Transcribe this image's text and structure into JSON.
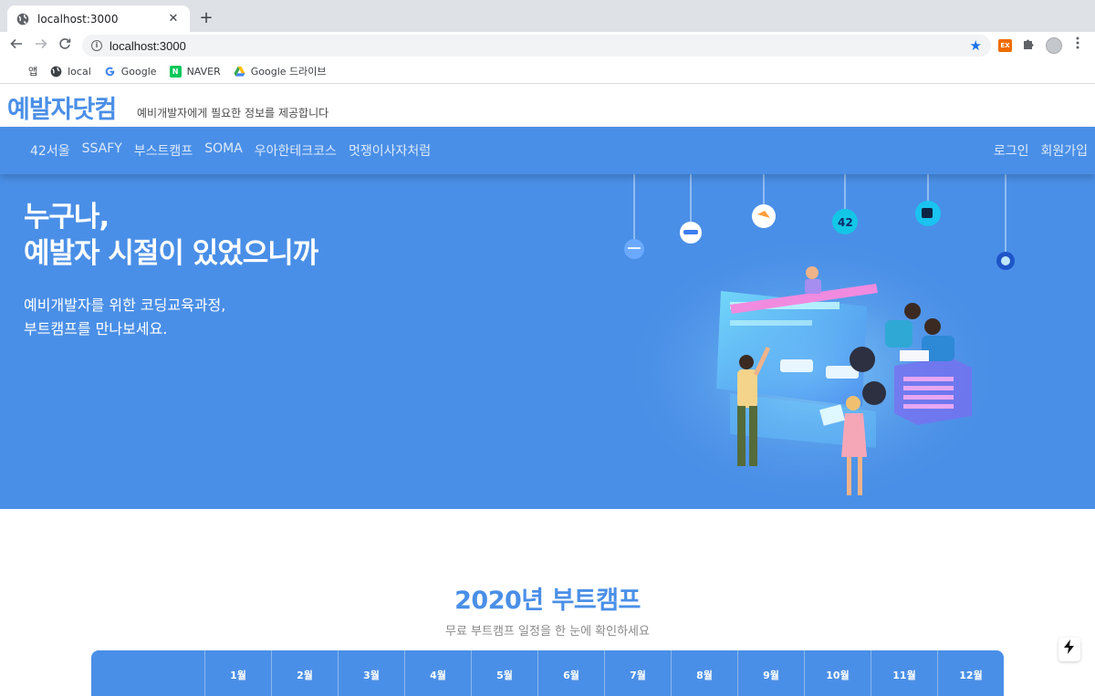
{
  "browser": {
    "tab_title": "localhost:3000",
    "tab_close": "✕",
    "new_tab": "+",
    "url": "localhost:3000",
    "ext_label": "EX",
    "bookmarks": [
      {
        "label": "앱",
        "icon": "apps-grid-icon"
      },
      {
        "label": "local",
        "icon": "globe-icon"
      },
      {
        "label": "Google",
        "icon": "google-icon"
      },
      {
        "label": "NAVER",
        "icon": "naver-icon"
      },
      {
        "label": "Google 드라이브",
        "icon": "drive-icon"
      }
    ]
  },
  "site": {
    "logo": "예발자닷컴",
    "tagline": "예비개발자에게 필요한 정보를 제공합니다"
  },
  "nav": {
    "left": [
      "42서울",
      "SSAFY",
      "부스트캠프",
      "SOMA",
      "우아한테크코스",
      "멋쟁이사자처럼"
    ],
    "login": "로그인",
    "signup": "회원가입"
  },
  "hero": {
    "title_line1": "누구나,",
    "title_line2": "예발자 시절이 있었으니까",
    "sub_line1": "예비개발자를 위한 코딩교육과정,",
    "sub_line2": "부트캠프를 만나보세요.",
    "badge_42": "42"
  },
  "section": {
    "title": "2020년 부트캠프",
    "subtitle": "무료 부트캠프 일정을 한 눈에 확인하세요",
    "months": [
      "1월",
      "2월",
      "3월",
      "4월",
      "5월",
      "6월",
      "7월",
      "8월",
      "9월",
      "10월",
      "11월",
      "12월"
    ]
  },
  "colors": {
    "brand": "#4a8fe7",
    "chrome_bg": "#dee1e6"
  }
}
